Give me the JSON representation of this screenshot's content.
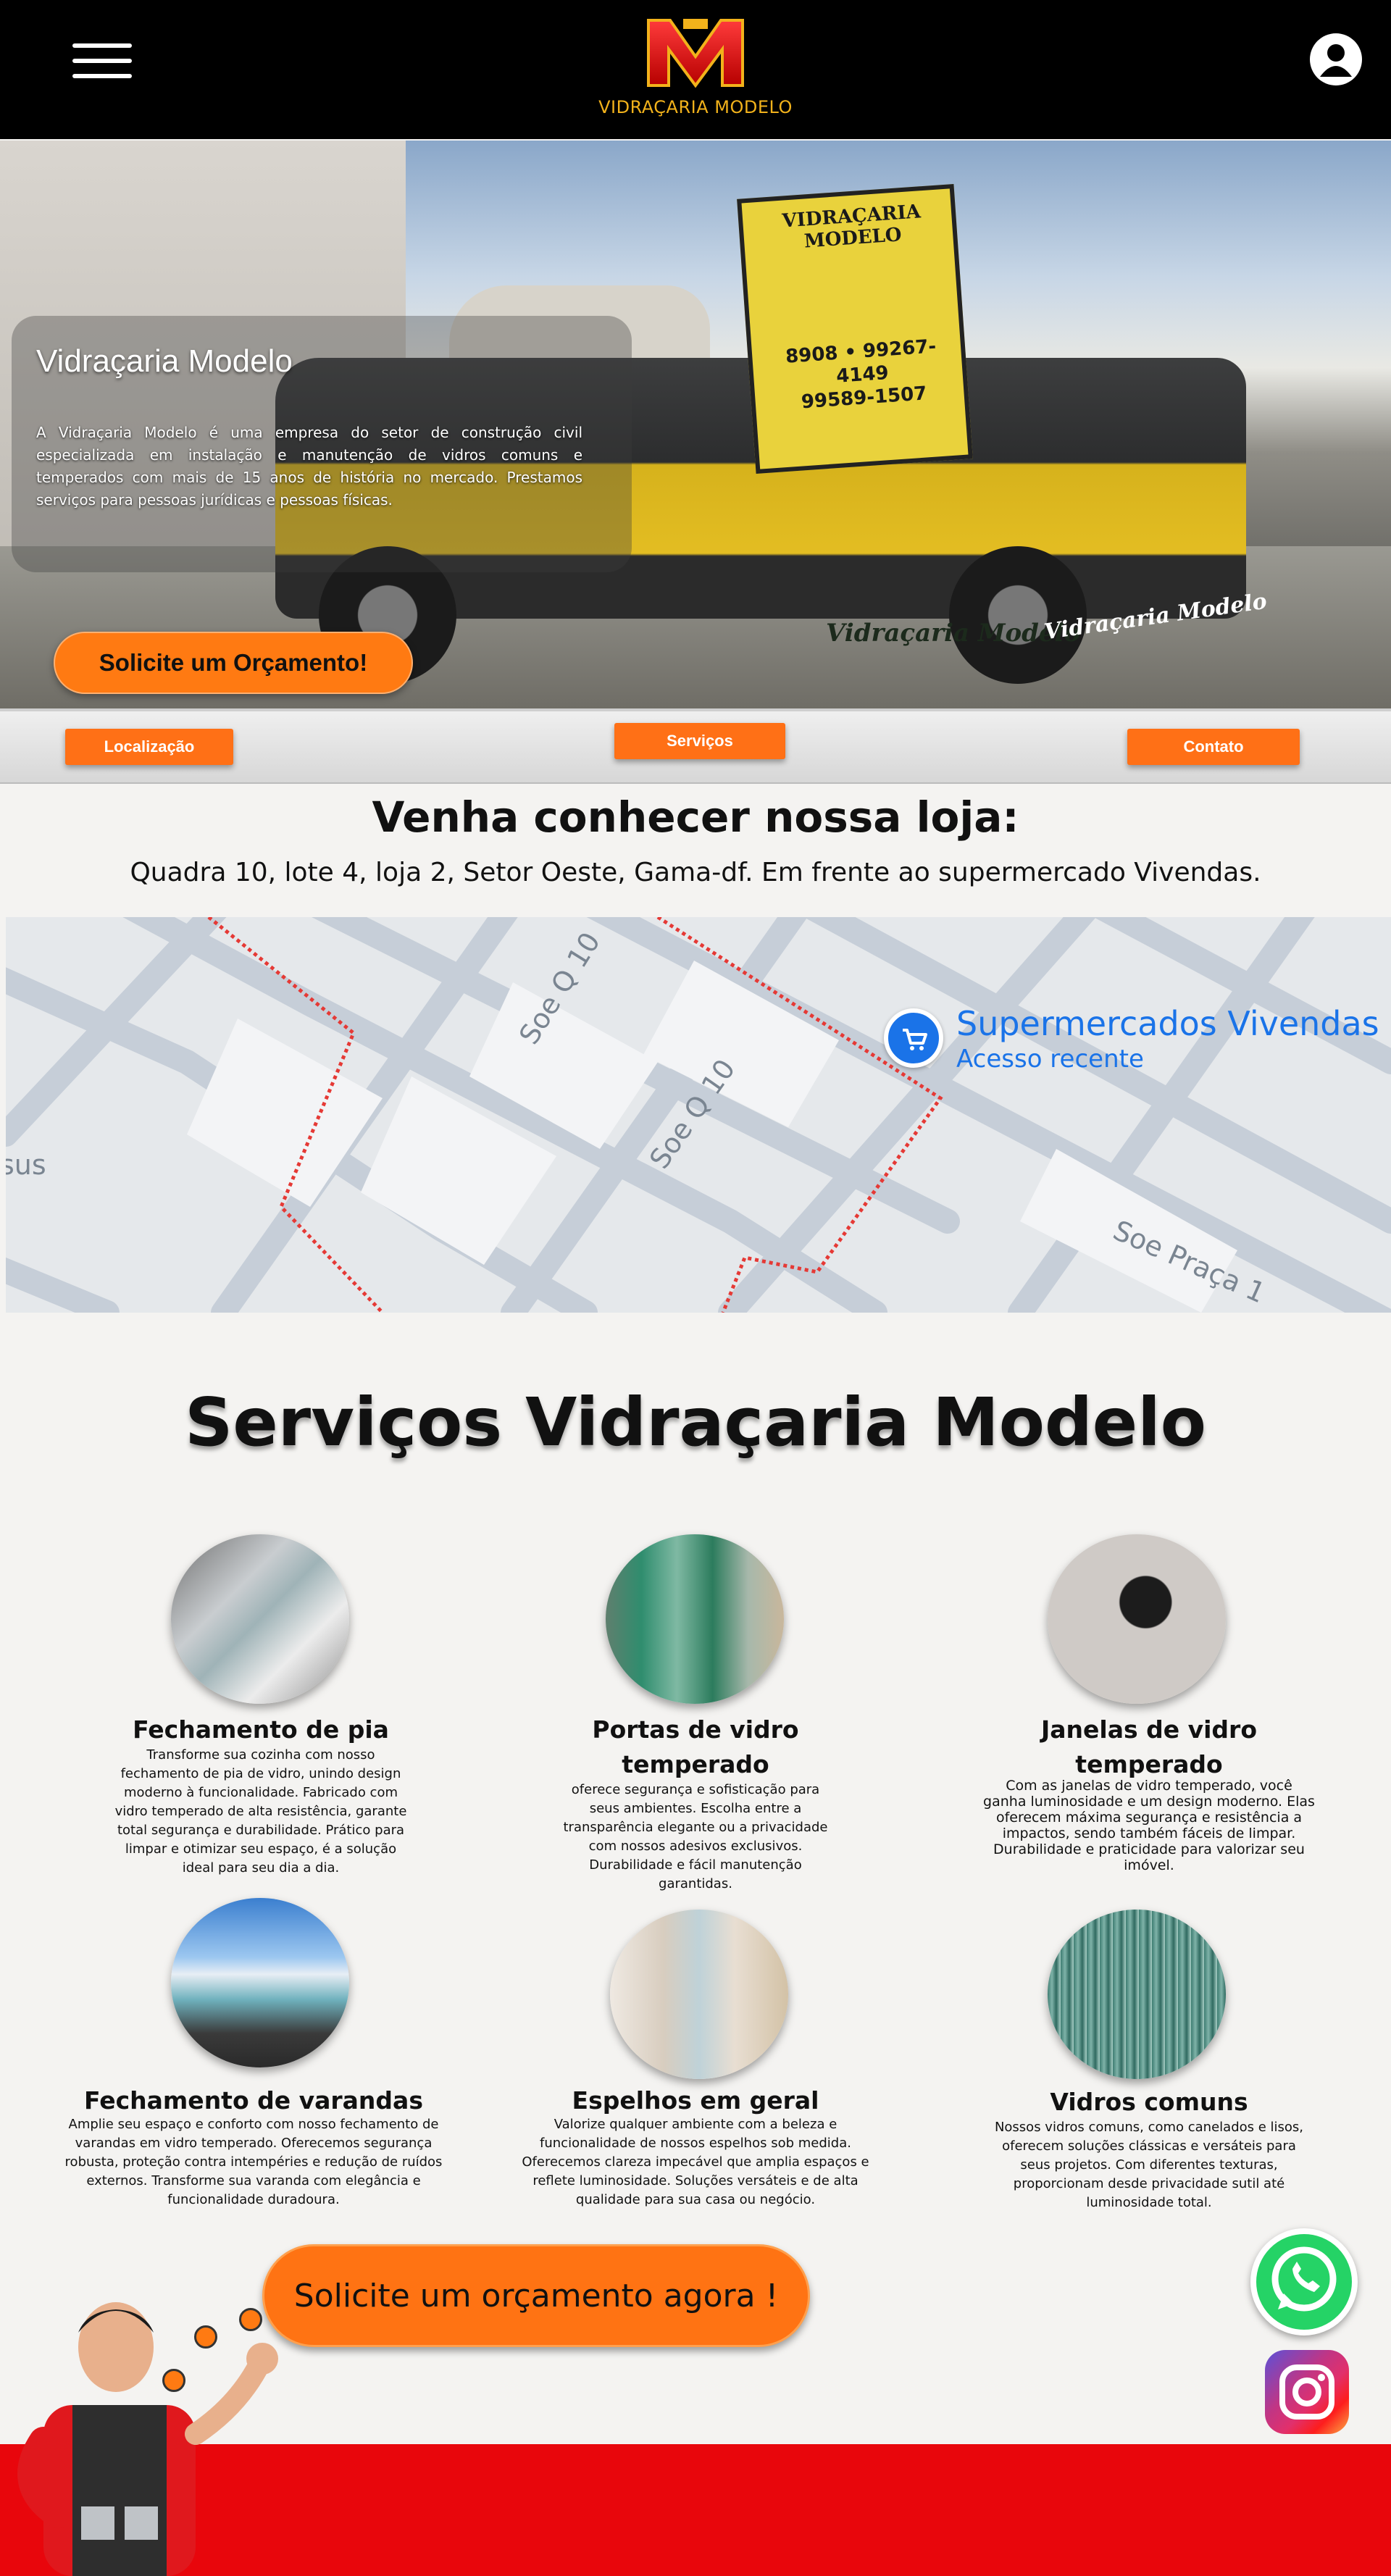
{
  "header": {
    "menu_icon": "hamburger-menu-icon",
    "logo_text": "VIDRAÇARIA MODELO",
    "user_icon": "user-icon"
  },
  "hero": {
    "title": "Vidraçaria Modelo",
    "text": "A Vidraçaria Modelo é uma empresa do setor de construção civil especializada em instalação e manutenção de vidros comuns e temperados  com mais de 15 anos de história no mercado. Prestamos serviços para pessoas jurídicas e pessoas físicas.",
    "cta_label": "Solicite um Orçamento!",
    "sign_title": "VIDRAÇARIA MODELO",
    "sign_phone": "8908 • 99267-4149\n99589-1507",
    "truck_brand": "Vidraçaria Modelo",
    "truck_brand2": "Vidraçaria Modelo"
  },
  "nav": {
    "location": "Localização",
    "services": "Serviços",
    "contact": "Contato"
  },
  "location": {
    "title": "Venha conhecer nossa loja:",
    "address": "Quadra 10, lote 4, loja 2, Setor Oeste, Gama-df. Em frente ao supermercado Vivendas."
  },
  "map": {
    "place_name": "Supermercados Vivendas",
    "place_sub": "Acesso recente",
    "street_1": "Soe Q 10",
    "street_2": "Soe Q 10",
    "street_3": "Soe Praça 1",
    "street_4": "sus",
    "pin_icon": "shopping-cart-icon"
  },
  "services": {
    "title": "Serviços Vidraçaria Modelo",
    "items": [
      {
        "name": "Fechamento de pia",
        "desc": "Transforme sua cozinha com nosso fechamento de pia de vidro, unindo design moderno à funcionalidade. Fabricado com vidro temperado de alta resistência, garante total segurança e durabilidade. Prático para limpar e otimizar seu espaço, é a solução ideal para seu dia a dia."
      },
      {
        "name": "Portas de vidro temperado",
        "desc": "oferece segurança e sofisticação para seus ambientes. Escolha entre a transparência elegante ou a privacidade com nossos adesivos exclusivos. Durabilidade e fácil manutenção garantidas."
      },
      {
        "name": "Janelas de vidro temperado",
        "desc": "Com as janelas de vidro temperado, você ganha luminosidade e um design moderno. Elas oferecem máxima segurança e resistência a impactos, sendo também fáceis de limpar. Durabilidade e praticidade para valorizar seu imóvel."
      },
      {
        "name": "Fechamento de varandas",
        "desc": "Amplie seu espaço e conforto com nosso fechamento de varandas em vidro temperado. Oferecemos segurança robusta, proteção contra intempéries e redução de ruídos externos. Transforme sua varanda com elegância e funcionalidade duradoura."
      },
      {
        "name": "Espelhos em geral",
        "desc": "Valorize qualquer ambiente com a beleza e funcionalidade de nossos espelhos sob medida. Oferecemos clareza impecável que amplia espaços e reflete luminosidade. Soluções versáteis e de alta qualidade para sua casa ou negócio."
      },
      {
        "name": "Vidros comuns",
        "desc": "Nossos vidros comuns, como canelados e lisos, oferecem soluções clássicas e versáteis para seus projetos. Com diferentes texturas, proporcionam desde privacidade sutil até luminosidade total."
      }
    ]
  },
  "bottom": {
    "cta_label": "Solicite um orçamento agora !",
    "whatsapp_icon": "whatsapp-icon",
    "instagram_icon": "instagram-icon"
  },
  "colors": {
    "accent": "#ff7a12",
    "header_bg": "#000000",
    "footer_band": "#e8060c",
    "logo_gold": "#f2b21b",
    "map_blue": "#1a73e8"
  }
}
